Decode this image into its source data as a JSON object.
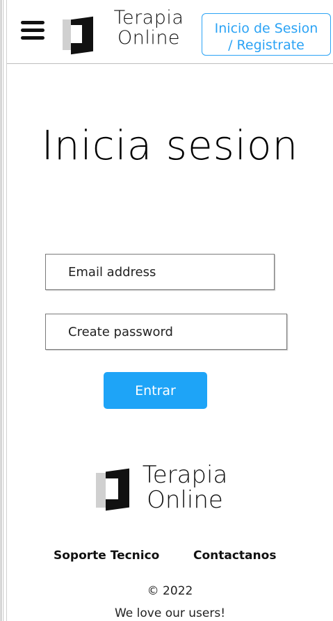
{
  "header": {
    "menu_icon": "hamburger-icon",
    "logo": {
      "icon": "terapia-logo-icon",
      "line1": "Terapia",
      "line2": "Online"
    },
    "login_button": {
      "line1": "Inicio de  Sesion",
      "line2": "/ Registrate"
    }
  },
  "main": {
    "title": "Inicia sesion",
    "email": {
      "placeholder": "Email address",
      "value": ""
    },
    "password": {
      "placeholder": "Create password",
      "value": ""
    },
    "submit_label": "Entrar"
  },
  "footer": {
    "logo": {
      "icon": "terapia-logo-icon",
      "line1": "Terapia",
      "line2": "Online"
    },
    "links": [
      "Soporte Tecnico",
      "Contactanos"
    ],
    "copyright": "© 2022",
    "tagline": "We love our users!"
  },
  "colors": {
    "accent": "#1ea4f7",
    "login_border": "#2ba3f5",
    "text": "#111111",
    "logo_gray": "#d0d0d0"
  }
}
